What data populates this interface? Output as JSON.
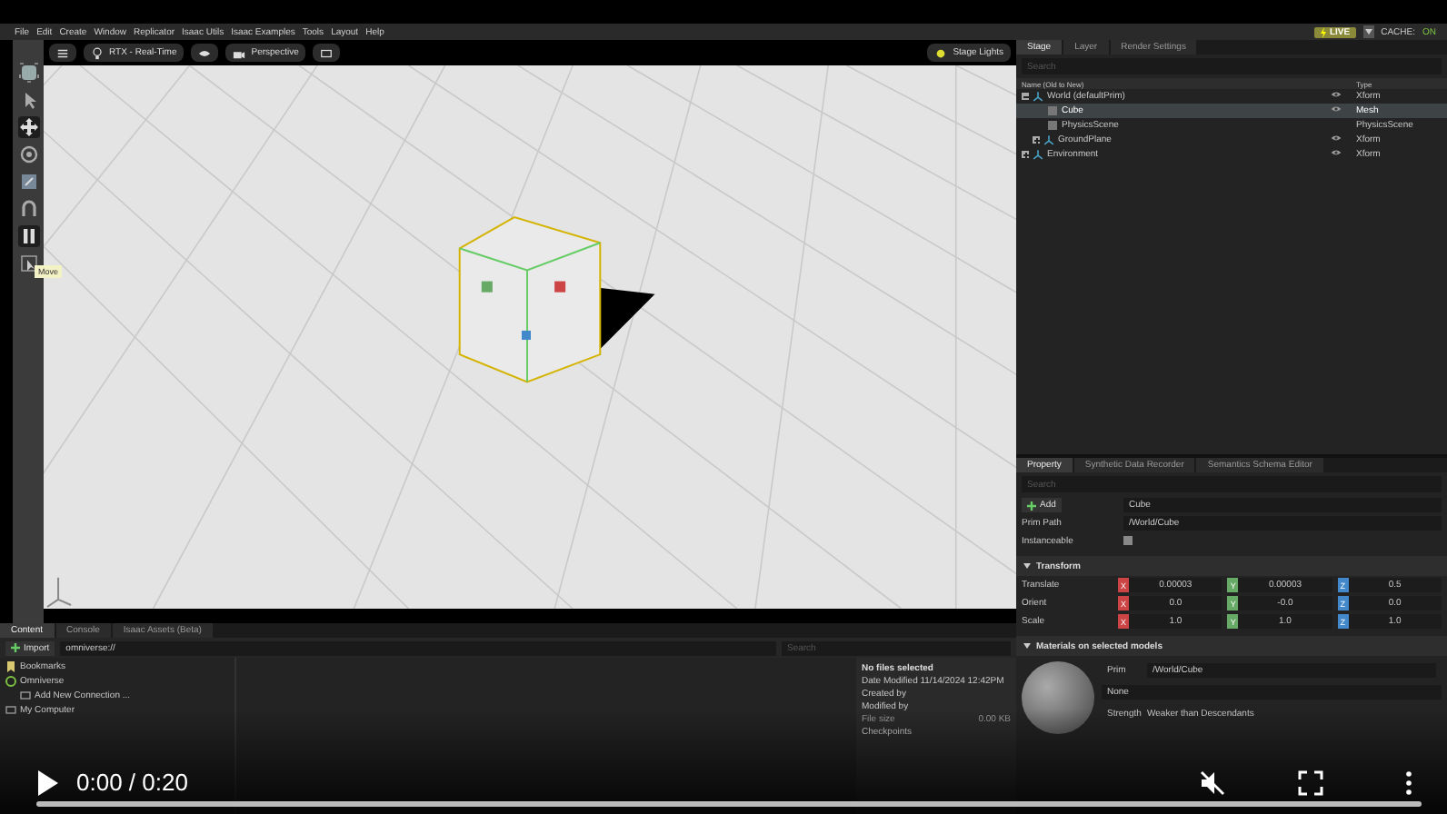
{
  "menu": [
    "File",
    "Edit",
    "Create",
    "Window",
    "Replicator",
    "Isaac Utils",
    "Isaac Examples",
    "Tools",
    "Layout",
    "Help"
  ],
  "status": {
    "live": "LIVE",
    "cache_label": "CACHE:",
    "cache_value": "ON"
  },
  "tools": [
    {
      "kind": "frame",
      "selected": false
    },
    {
      "kind": "select",
      "selected": false
    },
    {
      "kind": "move",
      "selected": true
    },
    {
      "kind": "rotate",
      "selected": false
    },
    {
      "kind": "scale",
      "selected": false
    },
    {
      "kind": "snap",
      "selected": false
    },
    {
      "kind": "pause",
      "selected": true
    },
    {
      "kind": "cursor",
      "selected": false
    }
  ],
  "tooltip": "Move",
  "viewport": {
    "renderer": "RTX - Real-Time",
    "camera": "Perspective",
    "lights": "Stage Lights"
  },
  "stage": {
    "tabs": [
      {
        "label": "Stage",
        "selected": true
      },
      {
        "label": "Layer",
        "selected": false
      },
      {
        "label": "Render Settings",
        "selected": false
      }
    ],
    "search": {
      "placeholder": "Search"
    },
    "columns": [
      "Name (Old to New)",
      "Type"
    ],
    "tree": [
      {
        "name": "World (defaultPrim)",
        "type": "Xform",
        "visible": true,
        "selected": false,
        "expanded": true,
        "children": [
          {
            "name": "Cube",
            "type": "Mesh",
            "visible": true,
            "selected": true
          },
          {
            "name": "PhysicsScene",
            "type": "PhysicsScene",
            "visible": false,
            "selected": false
          },
          {
            "name": "GroundPlane",
            "type": "Xform",
            "visible": true,
            "selected": false,
            "expanded": false
          }
        ]
      },
      {
        "name": "Environment",
        "type": "Xform",
        "visible": true,
        "selected": false,
        "expanded": false
      }
    ]
  },
  "property": {
    "tabs": [
      {
        "label": "Property",
        "selected": true
      },
      {
        "label": "Synthetic Data Recorder",
        "selected": false
      },
      {
        "label": "Semantics Schema Editor",
        "selected": false
      }
    ],
    "search": {
      "placeholder": "Search"
    },
    "add": "Add",
    "name": "Cube",
    "prim_path_label": "Prim Path",
    "prim_path": "/World/Cube",
    "instanceable_label": "Instanceable",
    "instanceable": false,
    "transform": {
      "title": "Transform",
      "rows": [
        {
          "label": "Translate",
          "axes": [
            "X",
            "Y",
            "Z"
          ],
          "values": [
            "0.00003",
            "0.00003",
            "0.5"
          ]
        },
        {
          "label": "Orient",
          "axes": [
            "X",
            "Y",
            "Z"
          ],
          "values": [
            "0.0",
            "-0.0",
            "0.0"
          ]
        },
        {
          "label": "Scale",
          "axes": [
            "X",
            "Y",
            "Z"
          ],
          "values": [
            "1.0",
            "1.0",
            "1.0"
          ]
        }
      ]
    },
    "materials": {
      "title": "Materials on selected models",
      "prim_label": "Prim",
      "prim": "/World/Cube",
      "material": "None",
      "strength_label": "Strength",
      "strength": "Weaker than Descendants"
    }
  },
  "content": {
    "tabs": [
      {
        "label": "Content",
        "selected": true
      },
      {
        "label": "Console",
        "selected": false
      },
      {
        "label": "Isaac Assets (Beta)",
        "selected": false
      }
    ],
    "import": "Import",
    "path": "omniverse://",
    "search": {
      "placeholder": "Search"
    },
    "tree": [
      {
        "name": "Bookmarks",
        "kind": "bookmark"
      },
      {
        "name": "Omniverse",
        "kind": "server"
      },
      {
        "name": "Add New Connection ...",
        "kind": "connection"
      },
      {
        "name": "My Computer",
        "kind": "computer"
      }
    ],
    "details": {
      "title": "No files selected",
      "date": "Date Modified 11/14/2024 12:42PM",
      "created": "Created by",
      "modified": "Modified by",
      "size_label": "File size",
      "size": "0.00 KB",
      "checkpoints": "Checkpoints"
    }
  },
  "video": {
    "time": "0:00 / 0:20",
    "level": 0
  }
}
